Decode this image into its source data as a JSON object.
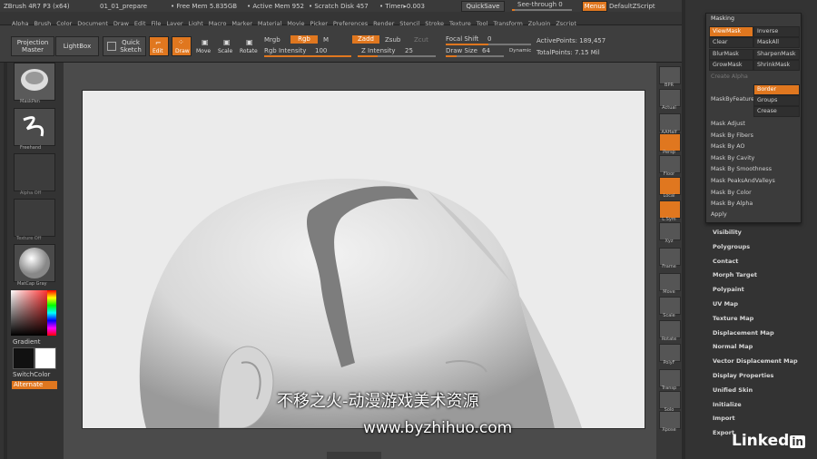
{
  "titlebar": {
    "app": "ZBrush 4R7 P3 (x64)",
    "file": "01_01_prepare",
    "free_mem": "• Free Mem 5.835GB",
    "active_mem": "• Active Mem 952",
    "scratch": "• Scratch Disk 457",
    "timer": "• Timer▸0.003",
    "quicksave": "QuickSave",
    "see_through": "See-through 0",
    "menus": "Menus",
    "script": "DefaultZScript"
  },
  "menubar": [
    "Alpha",
    "Brush",
    "Color",
    "Document",
    "Draw",
    "Edit",
    "File",
    "Layer",
    "Light",
    "Macro",
    "Marker",
    "Material",
    "Movie",
    "Picker",
    "Preferences",
    "Render",
    "Stencil",
    "Stroke",
    "Texture",
    "Tool",
    "Transform",
    "Zplugin",
    "Zscript"
  ],
  "shelf": {
    "projection_master": "Projection Master",
    "lightbox": "LightBox",
    "quick_sketch": "Quick Sketch",
    "edit": "Edit",
    "draw": "Draw",
    "move": "Move",
    "scale": "Scale",
    "rotate": "Rotate",
    "mrgb": "Mrgb",
    "rgb": "Rgb",
    "m": "M",
    "rgb_intensity_label": "Rgb Intensity",
    "rgb_intensity": "100",
    "zadd": "Zadd",
    "zsub": "Zsub",
    "zcut": "Zcut",
    "z_intensity_label": "Z Intensity",
    "z_intensity": "25",
    "focal_shift_label": "Focal Shift",
    "focal_shift": "0",
    "draw_size_label": "Draw Size",
    "draw_size": "64",
    "dynamic": "Dynamic",
    "active_points": "ActivePoints: 189,457",
    "total_points": "TotalPoints: 7.15 Mil"
  },
  "lefttray": {
    "brush": "MaskPen",
    "stroke": "Freehand",
    "alpha": "Alpha Off",
    "texture": "Texture Off",
    "material": "MatCap Gray",
    "gradient": "Gradient",
    "switchcolor": "SwitchColor",
    "alternate": "Alternate"
  },
  "rightstrip": [
    "BPR",
    "Actual",
    "AAHalf",
    "Persp",
    "Floor",
    "Local",
    "L.Sym",
    "Xyz",
    "Frame",
    "Move",
    "Scale",
    "Rotate",
    "PolyF",
    "Transp",
    "Solo",
    "Xpose"
  ],
  "masking": {
    "title": "Masking",
    "viewmask": "ViewMask",
    "inverse": "Inverse",
    "clear": "Clear",
    "maskall": "MaskAll",
    "blurmask": "BlurMask",
    "sharpenmask": "SharpenMask",
    "growmask": "GrowMask",
    "shrinkmask": "ShrinkMask",
    "create_alpha": "Create Alpha",
    "maskbyfeature": "MaskByFeature",
    "border": "Border",
    "groups": "Groups",
    "crease": "Crease",
    "items": [
      "Mask Adjust",
      "Mask By Fibers",
      "Mask By AO",
      "Mask By Cavity",
      "Mask By Smoothness",
      "Mask PeaksAndValleys",
      "Mask By Color",
      "Mask By Alpha"
    ],
    "apply": "Apply"
  },
  "subpalettes": [
    "Visibility",
    "Polygroups",
    "Contact",
    "Morph Target",
    "Polypaint",
    "UV Map",
    "Texture Map",
    "Displacement Map",
    "Normal Map",
    "Vector Displacement Map",
    "Display Properties",
    "Unified Skin",
    "Initialize",
    "Import",
    "Export"
  ],
  "watermark": {
    "line1": "不移之火-动漫游戏美术资源",
    "line2": "www.byzhihuo.com"
  },
  "brand": {
    "linked": "Linked",
    "in": "in"
  },
  "colors": {
    "accent": "#e0771f"
  }
}
